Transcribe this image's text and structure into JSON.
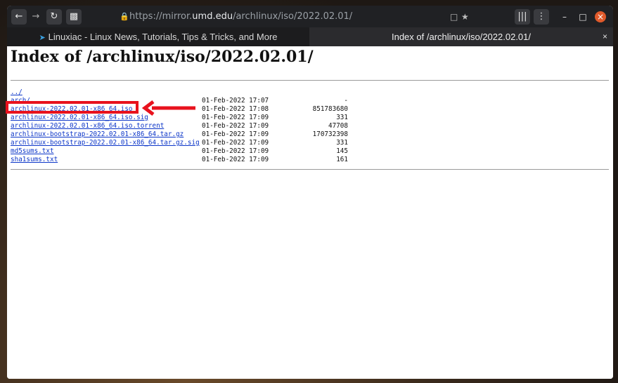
{
  "browser": {
    "url_prefix": "https://mirror.",
    "url_host": "umd.edu",
    "url_path": "/archlinux/iso/2022.02.01/",
    "icons": {
      "back": "back-arrow-icon",
      "forward": "forward-arrow-icon",
      "reload": "reload-icon",
      "container": "container-icon",
      "lock": "lock-icon",
      "reader": "reader-view-icon",
      "bookmark": "star-icon",
      "library": "library-icon",
      "menu": "menu-dots-icon"
    },
    "window_controls": {
      "minimize": "–",
      "maximize": "□",
      "close": "×"
    },
    "tabs": [
      {
        "title": "Linuxiac - Linux News, Tutorials, Tips & Tricks, and More",
        "active": false
      },
      {
        "title": "Index of /archlinux/iso/2022.02.01/",
        "active": true,
        "close": "×"
      }
    ]
  },
  "page": {
    "heading": "Index of /archlinux/iso/2022.02.01/",
    "entries": [
      {
        "name": "../",
        "date": "",
        "size": ""
      },
      {
        "name": "arch/",
        "date": "01-Feb-2022 17:07",
        "size": "-"
      },
      {
        "name": "archlinux-2022.02.01-x86_64.iso",
        "date": "01-Feb-2022 17:08",
        "size": "851783680",
        "highlighted": true
      },
      {
        "name": "archlinux-2022.02.01-x86_64.iso.sig",
        "date": "01-Feb-2022 17:09",
        "size": "331"
      },
      {
        "name": "archlinux-2022.02.01-x86_64.iso.torrent",
        "date": "01-Feb-2022 17:09",
        "size": "47708"
      },
      {
        "name": "archlinux-bootstrap-2022.02.01-x86_64.tar.gz",
        "date": "01-Feb-2022 17:09",
        "size": "170732398"
      },
      {
        "name": "archlinux-bootstrap-2022.02.01-x86_64.tar.gz.sig",
        "date": "01-Feb-2022 17:09",
        "size": "331"
      },
      {
        "name": "md5sums.txt",
        "date": "01-Feb-2022 17:09",
        "size": "145"
      },
      {
        "name": "sha1sums.txt",
        "date": "01-Feb-2022 17:09",
        "size": "161"
      }
    ]
  },
  "annotation": {
    "color": "#e8121d"
  }
}
